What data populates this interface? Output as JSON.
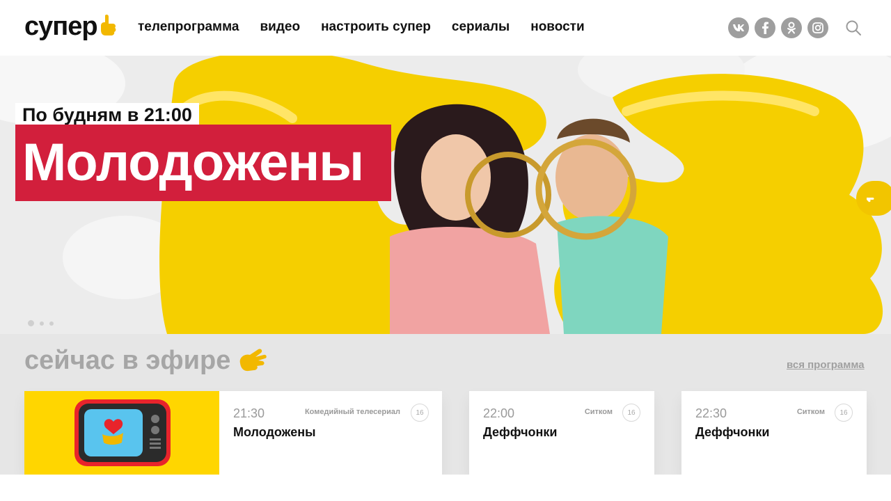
{
  "header": {
    "logo_text": "супер",
    "nav": [
      "телепрограмма",
      "видео",
      "настроить супер",
      "сериалы",
      "новости"
    ],
    "socials": [
      {
        "icon": "vk-icon",
        "glyph": "vk"
      },
      {
        "icon": "facebook-icon",
        "glyph": "f"
      },
      {
        "icon": "odnoklassniki-icon",
        "glyph": "ok"
      },
      {
        "icon": "instagram-icon",
        "glyph": "ig"
      }
    ],
    "search_icon": "search-icon"
  },
  "hero": {
    "schedule": "По будням в 21:00",
    "title": "Молодожены",
    "slides_total": 3,
    "active_slide": 1,
    "colors": {
      "title_bg": "#d21f3c",
      "balloon": "#f5cf00"
    }
  },
  "onair": {
    "title": "сейчас в эфире",
    "all_link": "вся программа",
    "cards": [
      {
        "time": "21:30",
        "genre": "Комедийный телесериал",
        "age": "16",
        "name": "Молодожены"
      },
      {
        "time": "22:00",
        "genre": "Ситком",
        "age": "16",
        "name": "Деффчонки"
      },
      {
        "time": "22:30",
        "genre": "Ситком",
        "age": "16",
        "name": "Деффчонки"
      }
    ]
  },
  "colors": {
    "accent_yellow": "#ffd600",
    "accent_red": "#d21f3c",
    "section_bg": "#e6e6e6"
  }
}
